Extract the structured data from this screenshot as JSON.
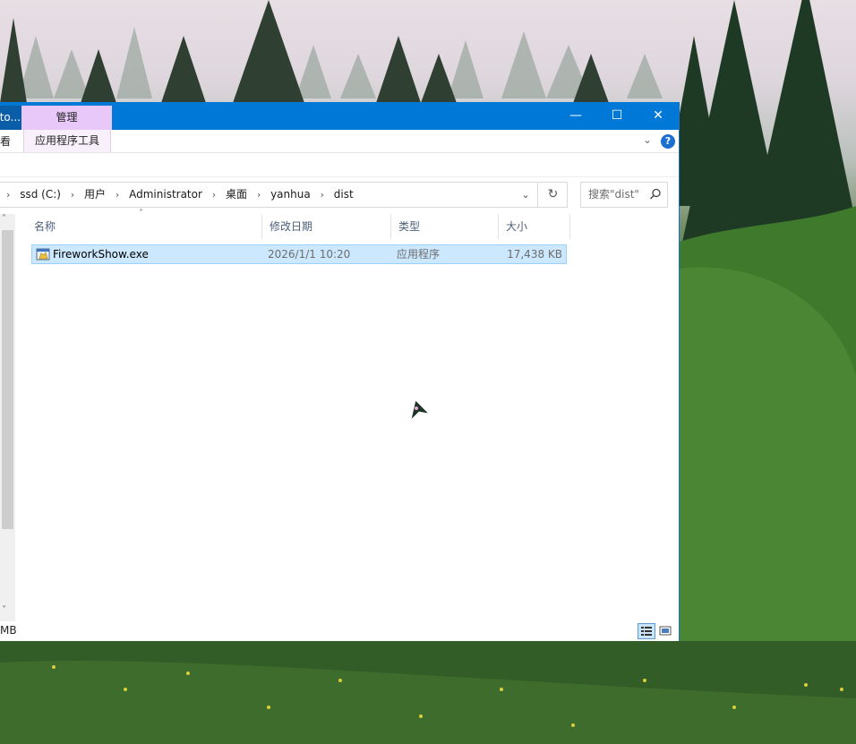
{
  "window": {
    "title_fragment": "cto...",
    "context_tab": "管理",
    "controls": {
      "minimize": "—",
      "maximize": "☐",
      "close": "✕"
    }
  },
  "ribbon": {
    "view_tab_fragment": "看",
    "app_tools_tab": "应用程序工具",
    "collapse_icon": "chevron-down-icon",
    "help_label": "?"
  },
  "address": {
    "crumbs": [
      "ssd (C:)",
      "用户",
      "Administrator",
      "桌面",
      "yanhua",
      "dist"
    ]
  },
  "search": {
    "placeholder": "搜索\"dist\""
  },
  "columns": {
    "name": "名称",
    "date": "修改日期",
    "type": "类型",
    "size": "大小"
  },
  "files": [
    {
      "name": "FireworkShow.exe",
      "date": "2026/1/1 10:20",
      "type": "应用程序",
      "size": "17,438 KB",
      "selected": true
    }
  ],
  "status": {
    "text_fragment": "MB"
  },
  "colors": {
    "titlebar": "#0078d7",
    "manage_tab": "#e8c8f8",
    "selection": "#cce8ff"
  }
}
